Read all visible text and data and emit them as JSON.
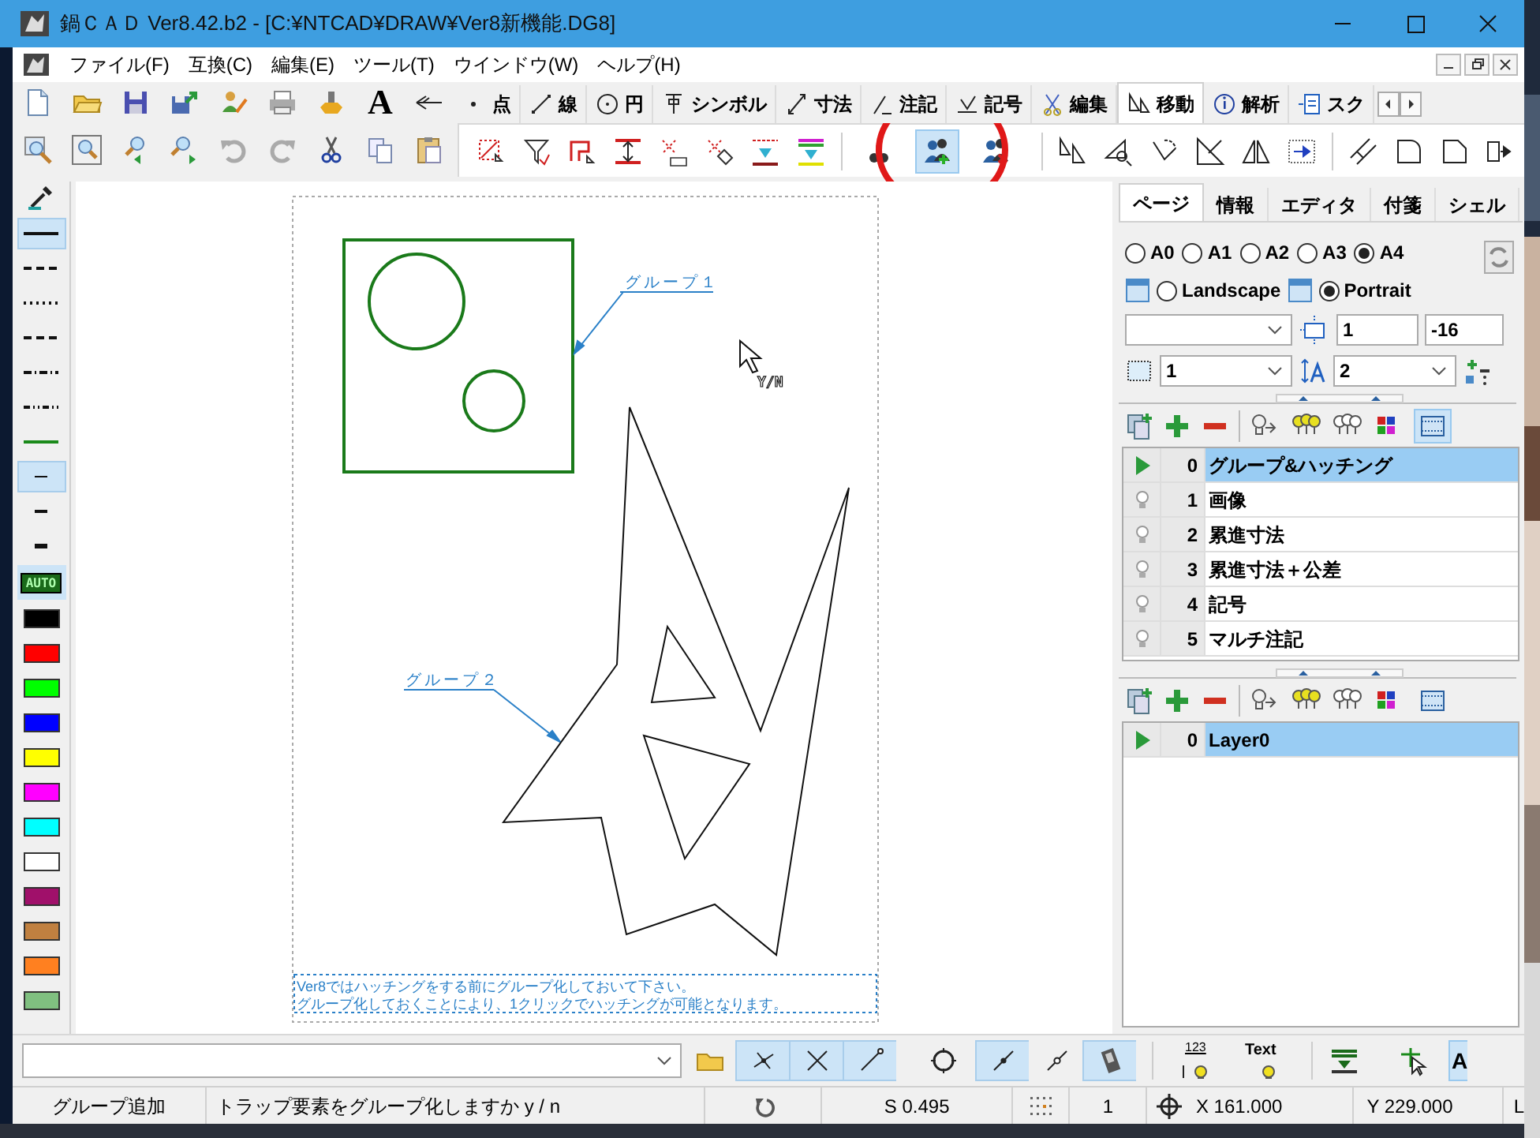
{
  "window": {
    "title": "鍋ＣＡＤ Ver8.42.b2 - [C:¥NTCAD¥DRAW¥Ver8新機能.DG8]"
  },
  "menu": [
    "ファイル(F)",
    "互換(C)",
    "編集(E)",
    "ツール(T)",
    "ウインドウ(W)",
    "ヘルプ(H)"
  ],
  "toolbar": {
    "text_tool": "A"
  },
  "mode_tabs": [
    {
      "label": "点",
      "selected": false
    },
    {
      "label": "線",
      "selected": false
    },
    {
      "label": "円",
      "selected": false
    },
    {
      "label": "シンボル",
      "selected": false
    },
    {
      "label": "寸法",
      "selected": false
    },
    {
      "label": "注記",
      "selected": false
    },
    {
      "label": "記号",
      "selected": false
    },
    {
      "label": "編集",
      "selected": false
    },
    {
      "label": "移動",
      "selected": true
    },
    {
      "label": "解析",
      "selected": false
    },
    {
      "label": "スク",
      "selected": false
    }
  ],
  "group_tools": [
    {
      "selected": false
    },
    {
      "selected": true
    },
    {
      "selected": false
    }
  ],
  "line_styles": [
    {
      "kind": "solid",
      "selected": true
    },
    {
      "kind": "dash",
      "selected": false
    },
    {
      "kind": "dot",
      "selected": false
    },
    {
      "kind": "dash",
      "selected": false
    },
    {
      "kind": "dashdot",
      "selected": false
    },
    {
      "kind": "dashdotdot",
      "selected": false
    }
  ],
  "line_widths": [
    {
      "kind": "thin",
      "selected": true
    },
    {
      "kind": "medium",
      "selected": false
    },
    {
      "kind": "thick",
      "selected": false
    }
  ],
  "auto_color": {
    "label": "AUTO",
    "selected": true
  },
  "colors": [
    {
      "color": "#000000"
    },
    {
      "color": "#ff0000"
    },
    {
      "color": "#00ff00"
    },
    {
      "color": "#0000ff"
    },
    {
      "color": "#ffff00"
    },
    {
      "color": "#ff00ff"
    },
    {
      "color": "#00ffff"
    },
    {
      "color": "#ffffff"
    },
    {
      "color": "#a0106a"
    },
    {
      "color": "#c08040"
    },
    {
      "color": "#ff8020"
    },
    {
      "color": "#80c080"
    }
  ],
  "canvas": {
    "labels": [
      "グループ１",
      "グループ２"
    ],
    "cursor_hint": "Y/N",
    "note": [
      "Ver8ではハッチングをする前にグループ化しておいて下さい。",
      "グループ化しておくことにより、1クリックでハッチングが可能となります。"
    ]
  },
  "right_panel": {
    "tabs": [
      {
        "label": "ページ",
        "selected": true
      },
      {
        "label": "情報",
        "selected": false
      },
      {
        "label": "エディタ",
        "selected": false
      },
      {
        "label": "付箋",
        "selected": false
      },
      {
        "label": "シェル",
        "selected": false
      }
    ],
    "paper_sizes": [
      {
        "label": "A0",
        "selected": false
      },
      {
        "label": "A1",
        "selected": false
      },
      {
        "label": "A2",
        "selected": false
      },
      {
        "label": "A3",
        "selected": false
      },
      {
        "label": "A4",
        "selected": true
      }
    ],
    "orientation": [
      {
        "label": "Landscape",
        "selected": false
      },
      {
        "label": "Portrait",
        "selected": true
      }
    ],
    "field_1": "1",
    "field_2": "-16",
    "field_3": "1",
    "field_4": "2",
    "layer_panels": [
      {
        "toggle_selected": true,
        "rows": [
          {
            "number": "0",
            "name": "グループ&ハッチング",
            "selected": true
          },
          {
            "number": "1",
            "name": "画像",
            "selected": false
          },
          {
            "number": "2",
            "name": "累進寸法",
            "selected": false
          },
          {
            "number": "3",
            "name": "累進寸法＋公差",
            "selected": false
          },
          {
            "number": "4",
            "name": "記号",
            "selected": false
          },
          {
            "number": "5",
            "name": "マルチ注記",
            "selected": false
          }
        ]
      },
      {
        "toggle_selected": false,
        "rows": [
          {
            "number": "0",
            "name": "Layer0",
            "selected": true
          }
        ]
      }
    ]
  },
  "bottom_bar": {
    "snap_buttons": [
      {
        "selected": true
      },
      {
        "selected": true
      },
      {
        "selected": true
      },
      {
        "selected": false
      },
      {
        "selected": true
      },
      {
        "selected": false
      },
      {
        "selected": true
      }
    ],
    "dimension_label": "123",
    "text_label": "Text",
    "cut_button": {
      "label": "A",
      "selected": true
    }
  },
  "status_bar": {
    "command": "グループ追加",
    "prompt": "トラップ要素をグループ化しますか y / n",
    "scale": "S 0.495",
    "layer": "1",
    "x": "X 161.000",
    "y": "Y 229.000",
    "column_7": "L"
  }
}
